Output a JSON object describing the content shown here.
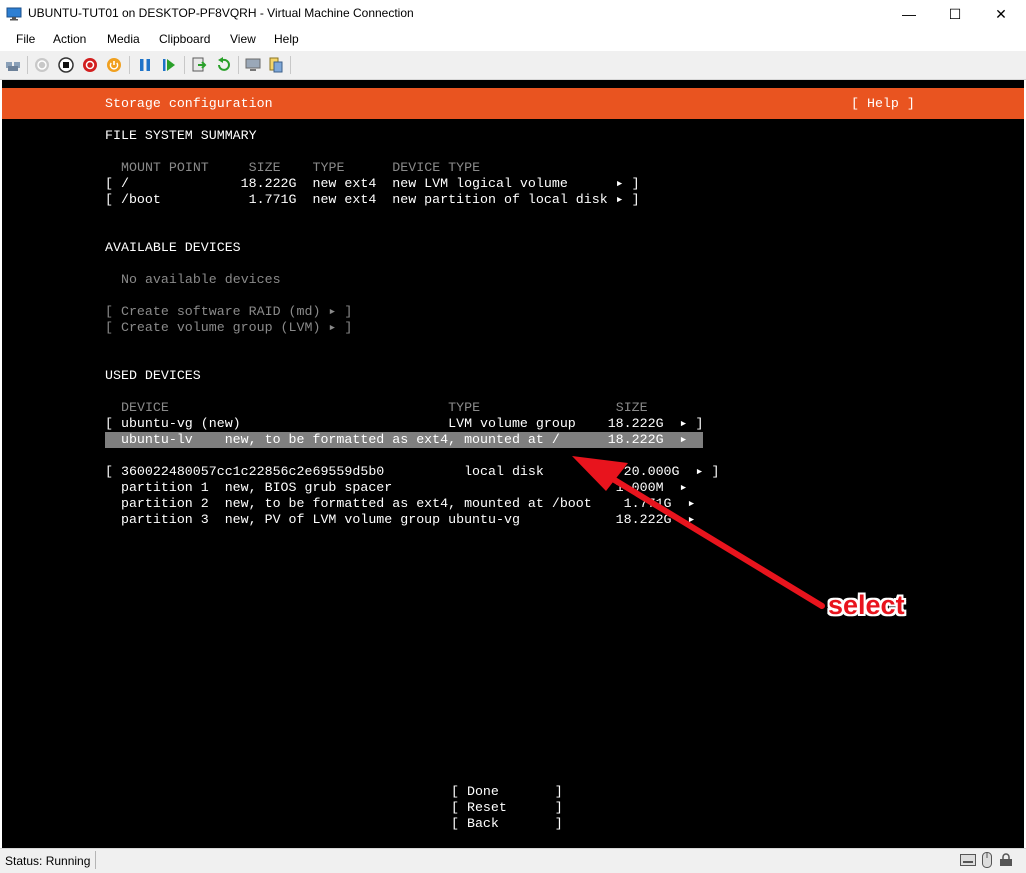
{
  "window": {
    "title": "UBUNTU-TUT01 on DESKTOP-PF8VQRH - Virtual Machine Connection",
    "minimize": "—",
    "maximize": "☐",
    "close": "✕"
  },
  "menu": [
    "File",
    "Action",
    "Media",
    "Clipboard",
    "View",
    "Help"
  ],
  "toolbar_icons": [
    "ctrl-alt-del-icon",
    "start-icon",
    "turn-off-icon",
    "shutdown-icon",
    "power-icon",
    "pause-icon",
    "resume-icon",
    "checkpoint-icon",
    "revert-icon",
    "enhanced-session-icon",
    "share-icon"
  ],
  "installer": {
    "header_title": "Storage configuration",
    "help": "[ Help ]",
    "fs_summary_title": "FILE SYSTEM SUMMARY",
    "fs_columns": "MOUNT POINT     SIZE    TYPE      DEVICE TYPE",
    "fs_rows": [
      "[ /              18.222G  new ext4  new LVM logical volume      ▸ ]",
      "[ /boot           1.771G  new ext4  new partition of local disk ▸ ]"
    ],
    "available_title": "AVAILABLE DEVICES",
    "no_available": "No available devices",
    "create_raid": "[ Create software RAID (md) ▸ ]",
    "create_vg": "[ Create volume group (LVM) ▸ ]",
    "used_title": "USED DEVICES",
    "used_columns": "DEVICE                                   TYPE                 SIZE",
    "used_vg_row": "[ ubuntu-vg (new)                          LVM volume group    18.222G  ▸ ]",
    "used_lv_row": "  ubuntu-lv    new, to be formatted as ext4, mounted at /      18.222G  ▸  ",
    "used_disk_row": "[ 360022480057cc1c22856c2e69559d5b0          local disk          20.000G  ▸ ]",
    "used_part1_row": "  partition 1  new, BIOS grub spacer                            1.000M  ▸",
    "used_part2_row": "  partition 2  new, to be formatted as ext4, mounted at /boot    1.771G  ▸",
    "used_part3_row": "  partition 3  new, PV of LVM volume group ubuntu-vg            18.222G  ▸",
    "done": "[ Done       ]",
    "reset": "[ Reset      ]",
    "back": "[ Back       ]"
  },
  "annotation": {
    "label": "select",
    "color": "#e8141d"
  },
  "status": {
    "text": "Status: Running"
  }
}
